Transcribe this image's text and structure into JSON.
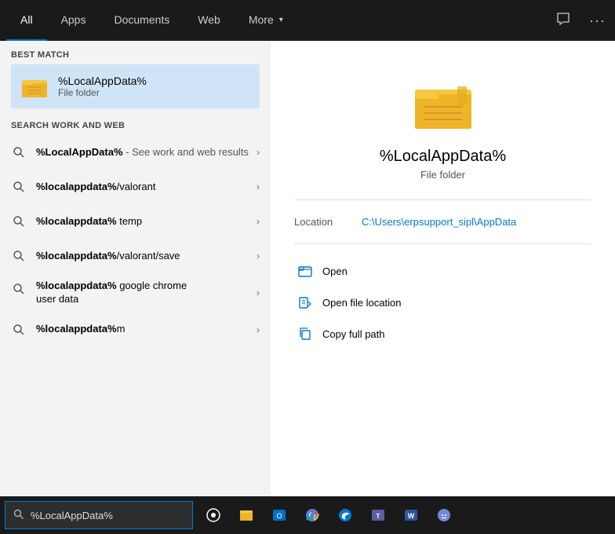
{
  "nav": {
    "tabs": [
      {
        "id": "all",
        "label": "All",
        "active": true
      },
      {
        "id": "apps",
        "label": "Apps"
      },
      {
        "id": "documents",
        "label": "Documents"
      },
      {
        "id": "web",
        "label": "Web"
      },
      {
        "id": "more",
        "label": "More",
        "hasDropdown": true
      }
    ],
    "icon_chat": "💬",
    "icon_more": "···"
  },
  "best_match": {
    "section_label": "Best match",
    "title": "%LocalAppData%",
    "subtitle": "File folder"
  },
  "search_work": {
    "section_label": "Search work and web"
  },
  "results": [
    {
      "text_bold": "%LocalAppData%",
      "text_dim": " - See work and web results",
      "multiline": true
    },
    {
      "text_bold": "%localappdata%",
      "text_rest": "/valorant"
    },
    {
      "text_bold": "%localappdata%",
      "text_rest": " temp"
    },
    {
      "text_bold": "%localappdata%",
      "text_rest": "/valorant/save"
    },
    {
      "text_bold": "%localappdata%",
      "text_rest": " google chrome user data",
      "multiline": true
    },
    {
      "text_bold": "%localappdata%",
      "text_rest": "m"
    }
  ],
  "detail": {
    "title": "%LocalAppData%",
    "subtitle": "File folder",
    "location_label": "Location",
    "location_value": "C:\\Users\\erpsupport_sipl\\AppData",
    "actions": [
      {
        "label": "Open",
        "icon": "folder-open"
      },
      {
        "label": "Open file location",
        "icon": "file-location"
      },
      {
        "label": "Copy full path",
        "icon": "copy"
      }
    ]
  },
  "taskbar": {
    "search_text": "%LocalAppData%",
    "search_placeholder": "%LocalAppData%"
  }
}
